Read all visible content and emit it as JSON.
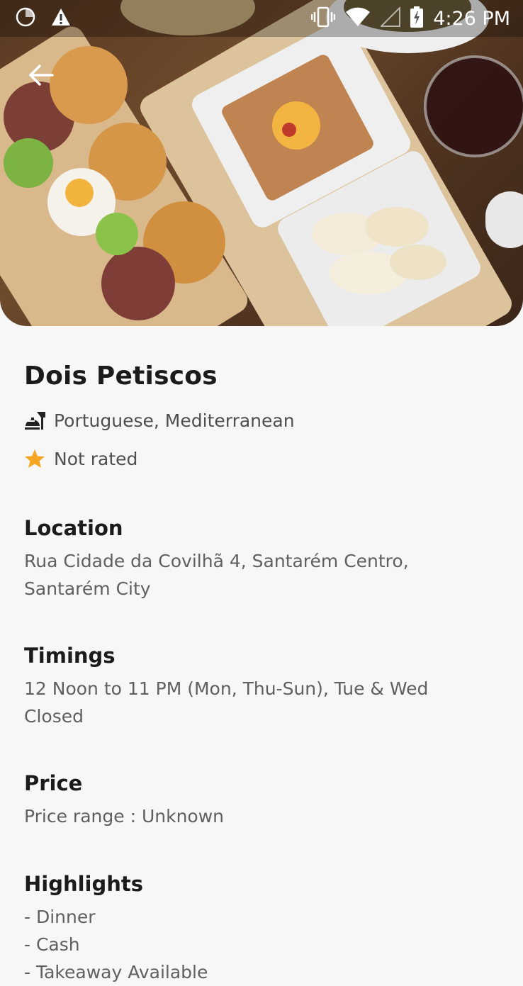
{
  "status_bar": {
    "time": "4:26 PM",
    "left_icons": [
      "loading-circle-icon",
      "warning-icon"
    ],
    "right_icons": [
      "vibrate-icon",
      "wifi-icon",
      "cell-signal-icon",
      "battery-charging-icon"
    ]
  },
  "hero": {
    "image": "food-photo",
    "back_icon": "arrow-left-icon"
  },
  "restaurant": {
    "name": "Dois Petiscos",
    "cuisines": "Portuguese, Mediterranean",
    "cuisine_icon": "food-cloche-icon",
    "rating": "Not rated",
    "rating_icon": "star-icon",
    "rating_color": "#f6a623"
  },
  "sections": {
    "location": {
      "title": "Location",
      "lines": [
        "Rua Cidade da Covilhã 4, Santarém Centro,",
        "Santarém City"
      ]
    },
    "timings": {
      "title": "Timings",
      "lines": [
        "12 Noon to 11 PM (Mon, Thu-Sun), Tue & Wed",
        "Closed"
      ]
    },
    "price": {
      "title": "Price",
      "lines": [
        "Price range : Unknown"
      ]
    },
    "highlights": {
      "title": "Highlights",
      "items": [
        "- Dinner",
        "- Cash",
        "- Takeaway Available"
      ]
    }
  }
}
